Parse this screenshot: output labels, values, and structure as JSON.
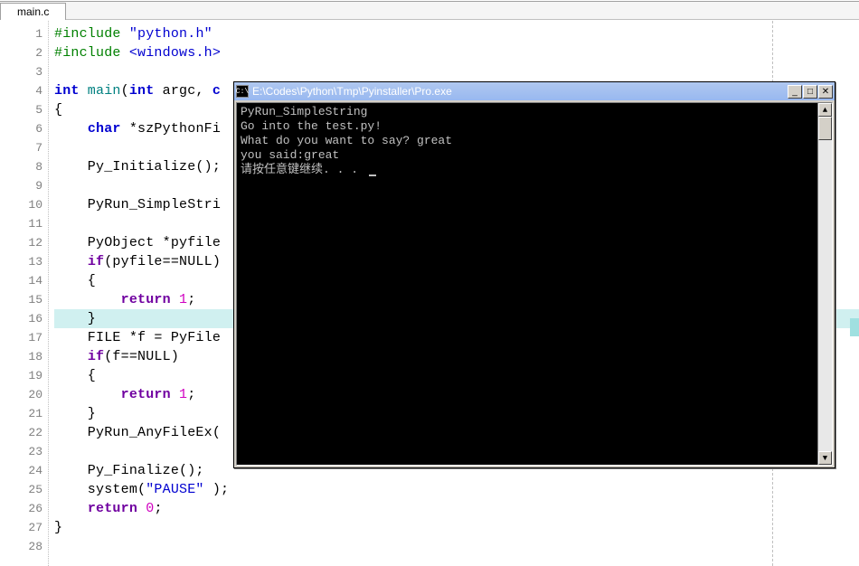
{
  "tab": {
    "label": "main.c"
  },
  "gutter": {
    "count": 28
  },
  "code": {
    "l1": {
      "a": "#include ",
      "b": "\"python.h\""
    },
    "l2": {
      "a": "#include ",
      "b": "<windows.h>"
    },
    "l4": {
      "a": "int",
      "b": " main",
      "c": "(",
      "d": "int",
      "e": " argc",
      "f": ", ",
      "g": "c"
    },
    "l5": {
      "a": "{"
    },
    "l6": {
      "a": "    ",
      "b": "char",
      "c": " *szPythonFi"
    },
    "l8": {
      "a": "    Py_Initialize();"
    },
    "l10": {
      "a": "    PyRun_SimpleStri"
    },
    "l12": {
      "a": "    PyObject *pyfile"
    },
    "l13": {
      "a": "    ",
      "b": "if",
      "c": "(pyfile==NULL)"
    },
    "l14": {
      "a": "    {"
    },
    "l15": {
      "a": "        ",
      "b": "return",
      "c": " ",
      "d": "1",
      "e": ";"
    },
    "l16": {
      "a": "    }"
    },
    "l17": {
      "a": "    FILE *f = PyFile"
    },
    "l18": {
      "a": "    ",
      "b": "if",
      "c": "(f==NULL)"
    },
    "l19": {
      "a": "    {"
    },
    "l20": {
      "a": "        ",
      "b": "return",
      "c": " ",
      "d": "1",
      "e": ";"
    },
    "l21": {
      "a": "    }"
    },
    "l22": {
      "a": "    PyRun_AnyFileEx("
    },
    "l24": {
      "a": "    Py_Finalize();"
    },
    "l25": {
      "a": "    system(",
      "b": "\"PAUSE\"",
      "c": " );"
    },
    "l26": {
      "a": "    ",
      "b": "return",
      "c": " ",
      "d": "0",
      "e": ";"
    },
    "l27": {
      "a": "}"
    }
  },
  "console": {
    "icon": "C:\\",
    "title": "E:\\Codes\\Python\\Tmp\\Pyinstaller\\Pro.exe",
    "minimize": "_",
    "maximize": "□",
    "close": "✕",
    "up": "▲",
    "down": "▼",
    "lines": {
      "l1": "PyRun_SimpleString",
      "l2": "Go into the test.py!",
      "l3": "What do you want to say? great",
      "l4": "you said:great",
      "l5": "请按任意键继续. . . "
    }
  }
}
